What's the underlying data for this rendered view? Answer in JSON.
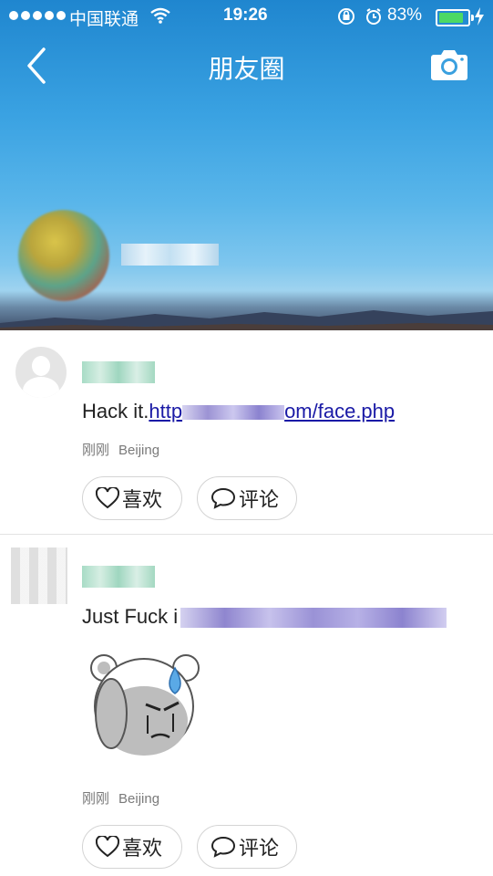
{
  "status_bar": {
    "carrier": "中国联通",
    "time": "19:26",
    "battery": "83%"
  },
  "nav": {
    "title": "朋友圈",
    "back_icon": "chevron-left-icon",
    "camera_icon": "camera-icon"
  },
  "posts": [
    {
      "text_prefix": "Hack it.",
      "link_start": "http",
      "link_end": "om/face.php",
      "time": "刚刚",
      "location": "Beijing",
      "like_label": "喜欢",
      "comment_label": "评论"
    },
    {
      "text_prefix": "Just Fuck i",
      "time": "刚刚",
      "location": "Beijing",
      "like_label": "喜欢",
      "comment_label": "评论",
      "sticker_icon": "crying-bear-sticker-icon"
    }
  ]
}
